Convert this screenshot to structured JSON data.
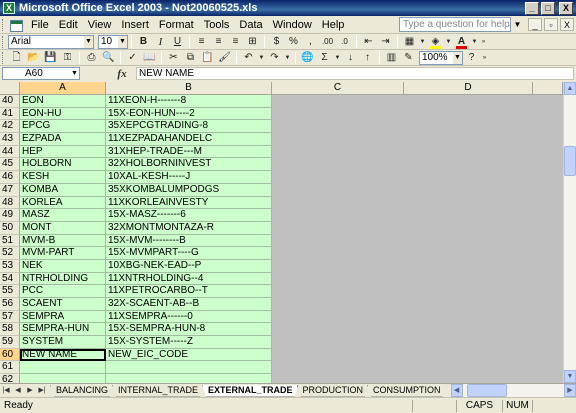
{
  "window": {
    "title": "Microsoft Office Excel 2003 - Not20060525.xls",
    "min_label": "_",
    "max_label": "□",
    "close_label": "X"
  },
  "menu": {
    "items": [
      "File",
      "Edit",
      "View",
      "Insert",
      "Format",
      "Tools",
      "Data",
      "Window",
      "Help"
    ],
    "help_placeholder": "Type a question for help",
    "mdi_min": "_",
    "mdi_restore": "▫",
    "mdi_close": "X"
  },
  "formatting_toolbar": {
    "font": "Arial",
    "size": "10",
    "bold": "B",
    "italic": "I",
    "underline": "U",
    "currency": "$",
    "percent": "%",
    "comma": ",",
    "increase_decimal": ".00",
    "decrease_decimal": ".0",
    "font_color_label": "A"
  },
  "standard_toolbar": {
    "sum_label": "Σ",
    "zoom": "100%",
    "help_label": "?"
  },
  "formula_bar": {
    "name_box": "A60",
    "fx_label": "fx",
    "formula": "NEW NAME"
  },
  "sheet": {
    "columns": [
      "A",
      "B",
      "C",
      "D"
    ],
    "rows": [
      {
        "n": "40",
        "a": "EON",
        "b": "11XEON-H-------8"
      },
      {
        "n": "41",
        "a": "EON-HU",
        "b": "15X-EON-HUN----2"
      },
      {
        "n": "42",
        "a": "EPCG",
        "b": "35XEPCGTRADING-8"
      },
      {
        "n": "43",
        "a": "EZPADA",
        "b": "11XEZPADAHANDELC"
      },
      {
        "n": "44",
        "a": "HEP",
        "b": "31XHEP-TRADE---M"
      },
      {
        "n": "45",
        "a": "HOLBORN",
        "b": "32XHOLBORNINVEST"
      },
      {
        "n": "46",
        "a": "KESH",
        "b": "10XAL-KESH-----J"
      },
      {
        "n": "47",
        "a": "KOMBA",
        "b": "35XKOMBALUMPODGS"
      },
      {
        "n": "48",
        "a": "KORLEA",
        "b": "11XKORLEAINVESTY"
      },
      {
        "n": "49",
        "a": "MASZ",
        "b": "15X-MASZ-------6"
      },
      {
        "n": "50",
        "a": "MONT",
        "b": "32XMONTMONTAZA-R"
      },
      {
        "n": "51",
        "a": "MVM-B",
        "b": "15X-MVM--------B"
      },
      {
        "n": "52",
        "a": "MVM-PART",
        "b": "15X-MVMPART----G"
      },
      {
        "n": "53",
        "a": "NEK",
        "b": "10XBG-NEK-EAD--P"
      },
      {
        "n": "54",
        "a": "NTRHOLDING",
        "b": "11XNTRHOLDING--4"
      },
      {
        "n": "55",
        "a": "PCC",
        "b": "11XPETROCARBO--T"
      },
      {
        "n": "56",
        "a": "SCAENT",
        "b": "32X-SCAENT-AB--B"
      },
      {
        "n": "57",
        "a": "SEMPRA",
        "b": "11XSEMPRA------0"
      },
      {
        "n": "58",
        "a": "SEMPRA-HUN",
        "b": "15X-SEMPRA-HUN-8"
      },
      {
        "n": "59",
        "a": "SYSTEM",
        "b": "15X-SYSTEM-----Z"
      },
      {
        "n": "60",
        "a": "NEW NAME",
        "b": "NEW_EIC_CODE"
      },
      {
        "n": "61",
        "a": "",
        "b": ""
      },
      {
        "n": "62",
        "a": "",
        "b": ""
      },
      {
        "n": "63",
        "a": "",
        "b": ""
      }
    ]
  },
  "tabs": [
    "BALANCING",
    "INTERNAL_TRADE",
    "EXTERNAL_TRADE",
    "PRODUCTION",
    "CONSUMPTION"
  ],
  "active_tab": "EXTERNAL_TRADE",
  "status": {
    "ready": "Ready",
    "caps": "CAPS",
    "num": "NUM"
  },
  "colors": {
    "title_bar": "#0a246a",
    "data_fill": "#ccffcc",
    "unused_area": "#c0c0c0"
  }
}
